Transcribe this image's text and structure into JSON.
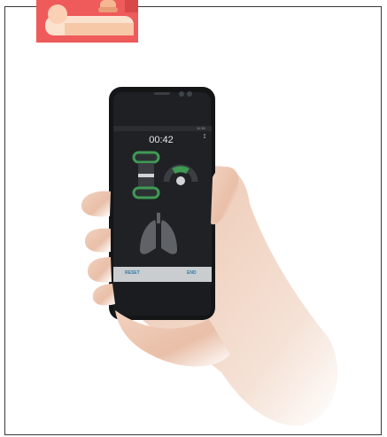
{
  "app": {
    "timer": "00:42",
    "status_bar": {
      "clock": "11:30"
    },
    "buttons": {
      "reset": "RESET",
      "end": "END"
    }
  },
  "icons": {
    "logo": "cpr-manikin-logo",
    "compression": "compression-indicator-icon",
    "gauge": "pressure-gauge-icon",
    "lungs": "lungs-icon",
    "menu": "overflow-menu-icon"
  },
  "colors": {
    "logo_bg": "#ef5a5a",
    "accent_green": "#3f9a54",
    "screen_bg": "#1f2124",
    "bottom_bar": "#c9cdd0",
    "button_text": "#2f7ea6"
  }
}
